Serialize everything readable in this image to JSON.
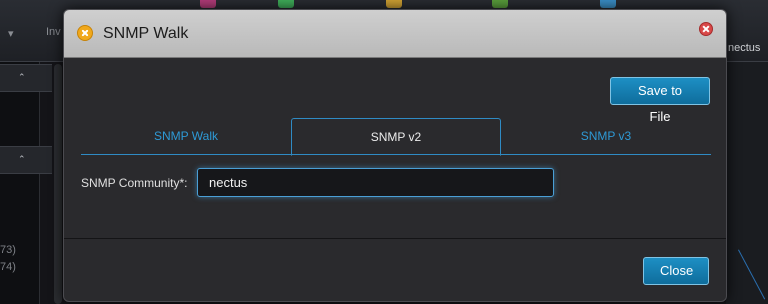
{
  "background": {
    "tab_text": "Inv",
    "right_text": "nectus",
    "numbers": [
      "73)",
      "74)"
    ]
  },
  "dialog": {
    "title": "SNMP Walk",
    "save_button": "Save to File",
    "tabs": [
      {
        "label": "SNMP Walk",
        "active": false
      },
      {
        "label": "SNMP v2",
        "active": true
      },
      {
        "label": "SNMP v3",
        "active": false
      }
    ],
    "community_label": "SNMP Community*:",
    "community_value": "nectus",
    "close_button": "Close"
  },
  "colors": {
    "accent": "#2e9ad6",
    "button": "#137aac",
    "header": "#c4c4c4"
  },
  "icons": {
    "title_icon": "tool-icon",
    "close_icon": "close-icon"
  }
}
